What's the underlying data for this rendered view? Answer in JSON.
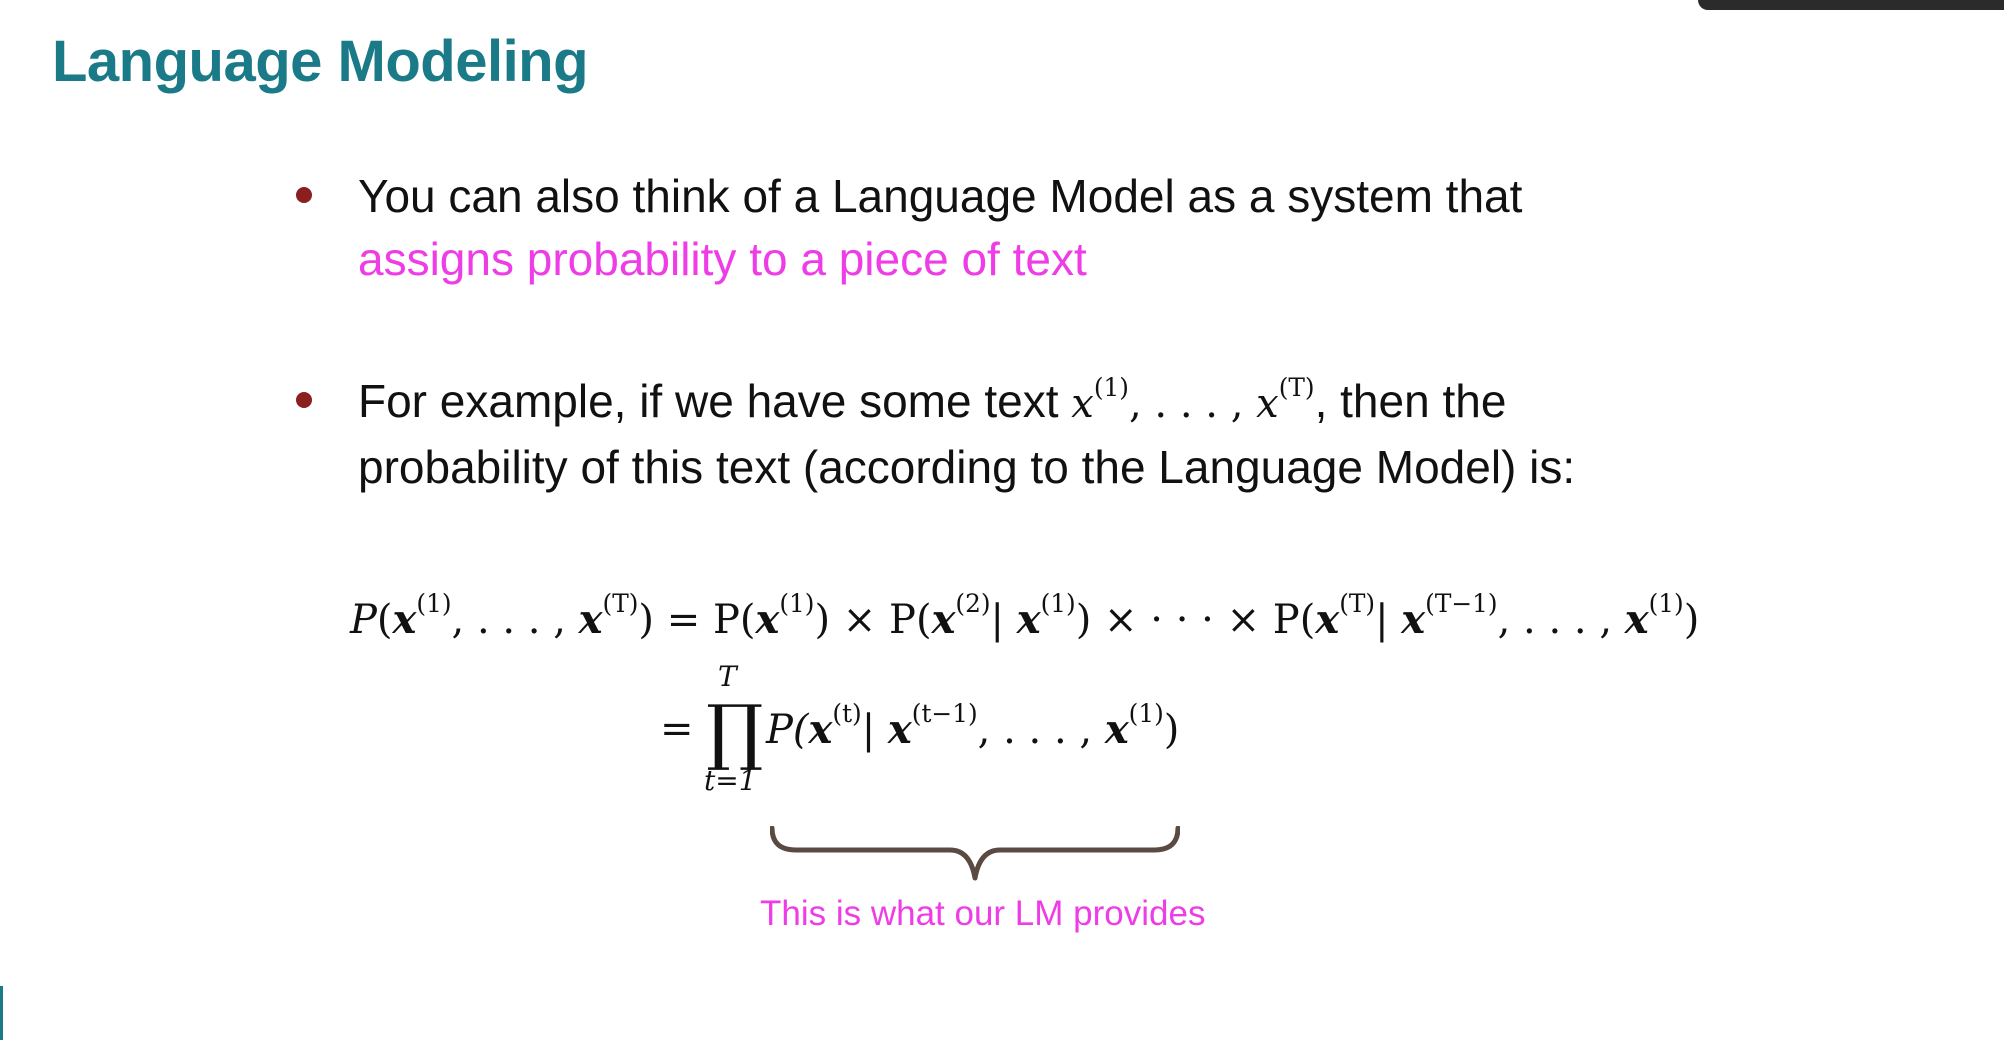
{
  "slide": {
    "title": "Language Modeling",
    "bullet1": {
      "text": "You can also think of a Language Model as a system that",
      "highlight": "assigns probability to a piece of text"
    },
    "bullet2": {
      "before": "For example, if we have some text",
      "math_x": "x",
      "sup_1": "(1)",
      "ellipsis": ", . . . , ",
      "sup_T": "(T)",
      "after": ", then the",
      "line2": "probability of this text (according to the Language Model) is:"
    },
    "equation": {
      "line1": {
        "P": "P",
        "open": "(",
        "x": "x",
        "sup1": "(1)",
        "dots": ", . . . , ",
        "supT": "(T)",
        "close_eq": ") = P(",
        "sup1b": "(1)",
        "times1": ") × P(",
        "sup2": "(2)",
        "bar1": "| ",
        "sup1c": "(1)",
        "times_dots": ") × · · · × P(",
        "supT2": "(T)",
        "bar2": "| ",
        "supTm1": "(T−1)",
        "dots2": ", . . . , ",
        "sup1d": "(1)",
        "end": ")"
      },
      "line2": {
        "eq": "=",
        "prod": "∏",
        "upper": "T",
        "lower": "t=1",
        "P": "P(",
        "supt": "(t)",
        "bar": "| ",
        "suptm1": "(t−1)",
        "dots": ", . . . , ",
        "sup1": "(1)",
        "end": ")"
      }
    },
    "caption": "This is what our LM provides",
    "colors": {
      "title": "#1a7a87",
      "highlight": "#ee3ce6",
      "bullet": "#8b1e1e",
      "brace": "#5a4a42"
    }
  }
}
